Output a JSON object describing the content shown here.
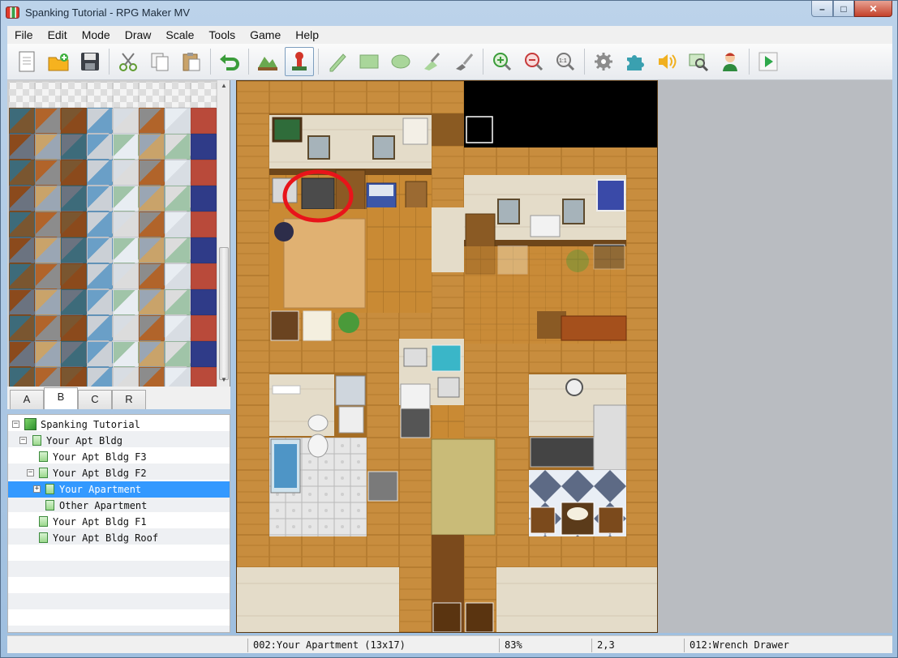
{
  "window": {
    "title": "Spanking Tutorial - RPG Maker MV",
    "min_label": "–",
    "max_label": "□",
    "close_label": "✕"
  },
  "menu": [
    "File",
    "Edit",
    "Mode",
    "Draw",
    "Scale",
    "Tools",
    "Game",
    "Help"
  ],
  "toolbar_icons": [
    "new-project-icon",
    "open-project-icon",
    "save-project-icon",
    "cut-icon",
    "copy-icon",
    "paste-icon",
    "undo-icon",
    "map-mode-icon",
    "event-mode-icon",
    "pencil-icon",
    "rectangle-icon",
    "ellipse-icon",
    "flood-fill-icon",
    "shadow-pen-icon",
    "zoom-in-icon",
    "zoom-out-icon",
    "actual-size-icon",
    "database-icon",
    "plugin-manager-icon",
    "sound-test-icon",
    "event-search-icon",
    "character-generator-icon",
    "playtest-icon"
  ],
  "tileset_tabs": [
    "A",
    "B",
    "C",
    "R"
  ],
  "active_tab": "B",
  "map_tree": [
    {
      "label": "Spanking Tutorial",
      "level": 0,
      "expand": "−",
      "kind": "project"
    },
    {
      "label": "Your Apt Bldg",
      "level": 1,
      "expand": "−",
      "kind": "map"
    },
    {
      "label": "Your Apt Bldg F3",
      "level": 2,
      "expand": "",
      "kind": "map"
    },
    {
      "label": "Your Apt Bldg F2",
      "level": 2,
      "expand": "−",
      "kind": "map"
    },
    {
      "label": "Your Apartment",
      "level": 3,
      "expand": "+",
      "kind": "map",
      "selected": true
    },
    {
      "label": "Other Apartment",
      "level": 4,
      "expand": "",
      "kind": "map"
    },
    {
      "label": "Your Apt Bldg F1",
      "level": 2,
      "expand": "",
      "kind": "map"
    },
    {
      "label": "Your Apt Bldg Roof",
      "level": 2,
      "expand": "",
      "kind": "map"
    }
  ],
  "status": {
    "map": "002:Your Apartment (13x17)",
    "zoom": "83%",
    "coords": "2,3",
    "event": "012:Wrench Drawer"
  },
  "colors": {
    "selection": "#3399ff",
    "highlight_circle": "#e8141a",
    "floor_wood": "#c88d3e",
    "wall": "#e4dcc9"
  }
}
